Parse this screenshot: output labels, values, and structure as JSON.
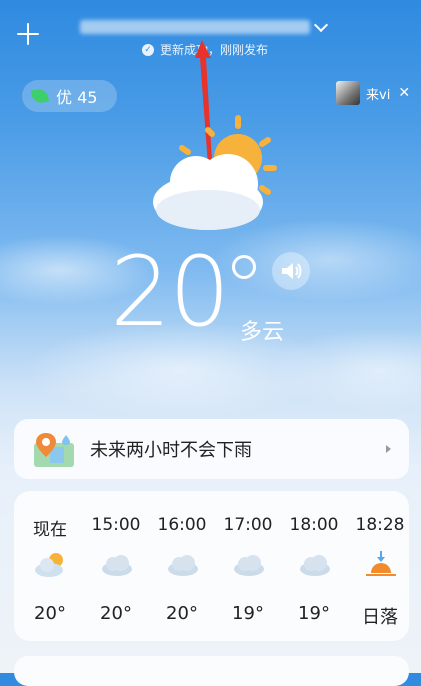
{
  "header": {
    "location": "市 · 北京区 · 1区",
    "update_status": "更新成功，刚刚发布"
  },
  "aqi": {
    "label": "优 45"
  },
  "ad": {
    "label": "来vi"
  },
  "current": {
    "temperature": "20",
    "condition": "多云"
  },
  "rain_alert": {
    "text": "未来两小时不会下雨"
  },
  "hourly": [
    {
      "time": "现在",
      "icon": "partly-cloudy-icon",
      "temp": "20°"
    },
    {
      "time": "15:00",
      "icon": "cloud-icon",
      "temp": "20°"
    },
    {
      "time": "16:00",
      "icon": "cloud-icon",
      "temp": "20°"
    },
    {
      "time": "17:00",
      "icon": "cloud-icon",
      "temp": "19°"
    },
    {
      "time": "18:00",
      "icon": "cloud-icon",
      "temp": "19°"
    },
    {
      "time": "18:28",
      "icon": "sunset-icon",
      "temp": "日落"
    }
  ],
  "colors": {
    "accent": "#3a90e2",
    "aqi_green": "#3fcf6a",
    "sun": "#f7b23b"
  }
}
